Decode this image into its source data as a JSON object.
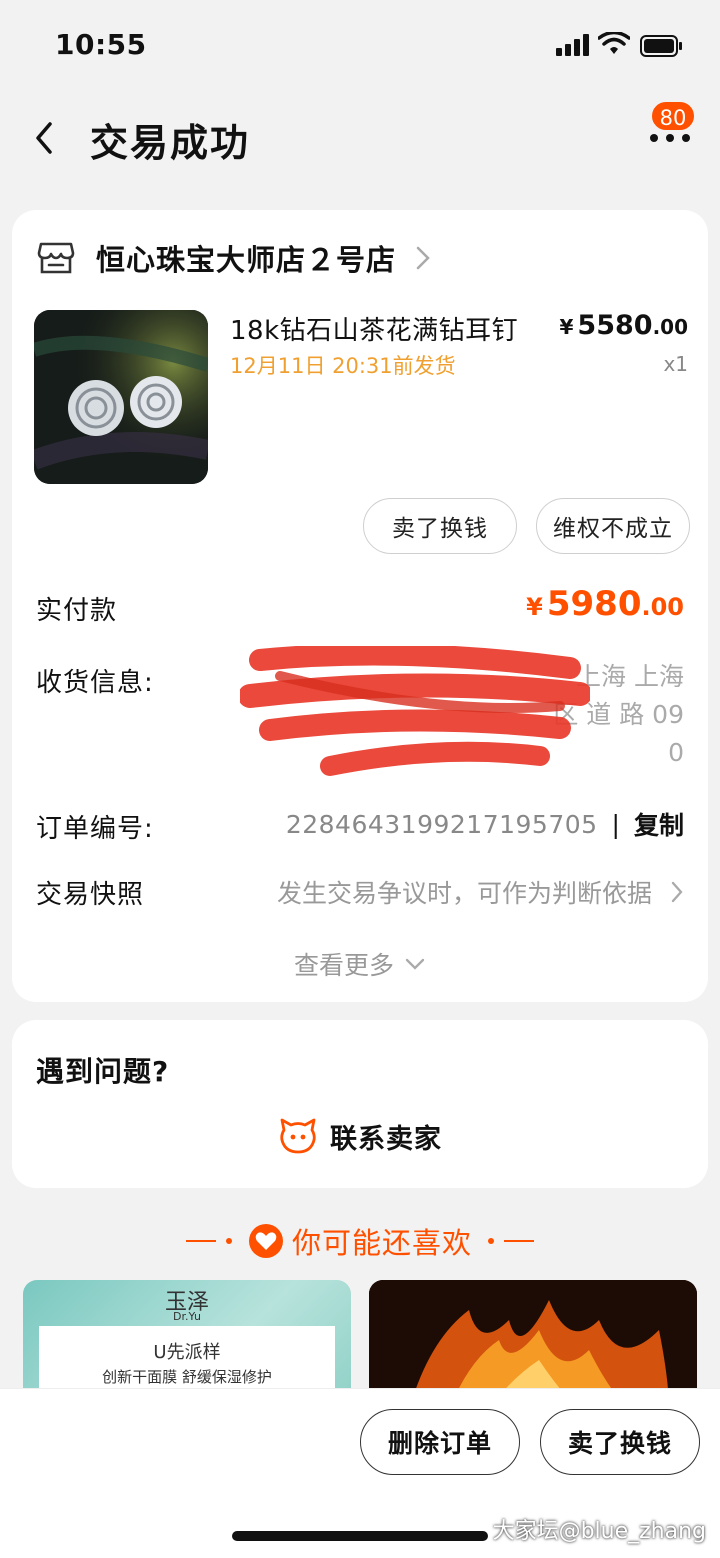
{
  "status_bar": {
    "time": "10:55"
  },
  "nav": {
    "title": "交易成功",
    "badge": "80"
  },
  "shop": {
    "name": "恒心珠宝大师店２号店"
  },
  "product": {
    "title": "18k钻石山茶花满钻耳钉",
    "ship_time": "12月11日 20:31前发货",
    "price_symbol": "¥",
    "price_int": "5580",
    "price_dec": ".00",
    "quantity": "x1"
  },
  "actions": {
    "sell_label": "卖了换钱",
    "rights_label": "维权不成立"
  },
  "payment": {
    "label": "实付款",
    "symbol": "¥",
    "amount_int": "5980",
    "amount_dec": ".00"
  },
  "address": {
    "label": "收货信息:",
    "lines": [
      "上海 上海",
      "区 道 路 09",
      "0"
    ]
  },
  "order": {
    "label": "订单编号:",
    "number": "2284643199217195705",
    "separator": "|",
    "copy_label": "复制"
  },
  "snapshot": {
    "label": "交易快照",
    "hint": "发生交易争议时，可作为判断依据"
  },
  "see_more": "查看更多",
  "help": {
    "title": "遇到问题?",
    "contact_label": "联系卖家"
  },
  "recommend": {
    "title": "你可能还喜欢",
    "left": {
      "brand": "玉泽",
      "brand_sub": "Dr.Yu",
      "tagline": "U先派样",
      "desc": "创新干面膜 舒缓保湿修护"
    }
  },
  "bottom": {
    "delete_label": "删除订单",
    "sell_label": "卖了换钱",
    "watermark": "大家坛@blue_zhang"
  },
  "colors": {
    "accent": "#ff5000",
    "ship": "#f0a030",
    "bg": "#f2f2f2"
  }
}
